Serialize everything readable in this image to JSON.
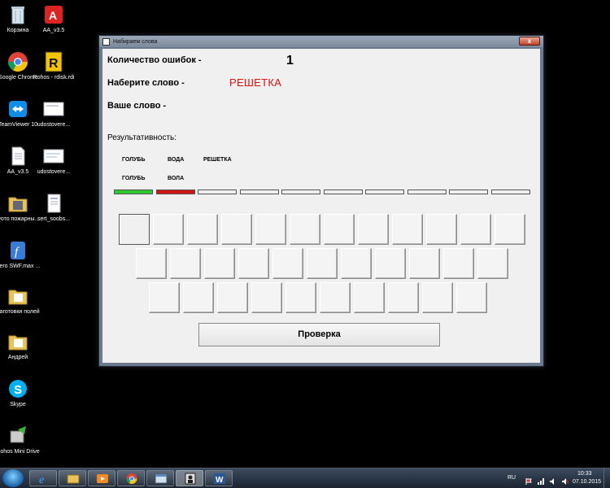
{
  "desktop": {
    "icons": [
      {
        "label": "Корзина",
        "icon": "recycle-bin-icon"
      },
      {
        "label": "AA_v3.5",
        "icon": "aa-app-icon"
      },
      {
        "label": "Google Chrome",
        "icon": "chrome-icon"
      },
      {
        "label": "Rohos - rdisk.rdi",
        "icon": "rohos-disk-icon"
      },
      {
        "label": "TeamViewer 10",
        "icon": "teamviewer-icon"
      },
      {
        "label": "udostovere...",
        "icon": "document-icon"
      },
      {
        "label": "AA_v3.5",
        "icon": "file-icon"
      },
      {
        "label": "udostovere...",
        "icon": "document-icon"
      },
      {
        "label": "Фото пожарны...",
        "icon": "folder-icon"
      },
      {
        "label": "sert_soobs...",
        "icon": "certificate-icon"
      },
      {
        "label": "Aero SWF.max ...",
        "icon": "aero-swf-icon"
      },
      {
        "label": "Заготовки полей",
        "icon": "folder-icon"
      },
      {
        "label": "Андрей",
        "icon": "folder-icon"
      },
      {
        "label": "Skype",
        "icon": "skype-icon"
      },
      {
        "label": "Rohos Mini Drive",
        "icon": "rohos-mini-icon"
      }
    ]
  },
  "window": {
    "title": "Набираем слова",
    "close_label": "x",
    "errors_label": "Количество ошибок -",
    "errors_value": "1",
    "type_word_label": "Наберите слово -",
    "target_word": "РЕШЕТКА",
    "your_word_label": "Ваше слово -",
    "your_word_value": "",
    "performance_label": "Результативность:",
    "given_words": [
      "ГОЛУБЬ",
      "ВОДА",
      "РЕШЕТКА"
    ],
    "typed_words": [
      "ГОЛУБЬ",
      "ВОЛА"
    ],
    "result_bars": [
      "correct",
      "wrong",
      "empty",
      "empty",
      "empty",
      "empty",
      "empty",
      "empty",
      "empty",
      "empty"
    ],
    "colors": {
      "correct": "#2dc82d",
      "wrong": "#d21414",
      "target": "#e21010"
    },
    "check_button": "Проверка"
  },
  "taskbar": {
    "items": [
      "ie-icon",
      "explorer-icon",
      "media-player-icon",
      "chrome-icon",
      "window-icon",
      "app-icon",
      "word-icon"
    ],
    "language": "RU",
    "time": "10:33",
    "date": "07.10.2015"
  }
}
